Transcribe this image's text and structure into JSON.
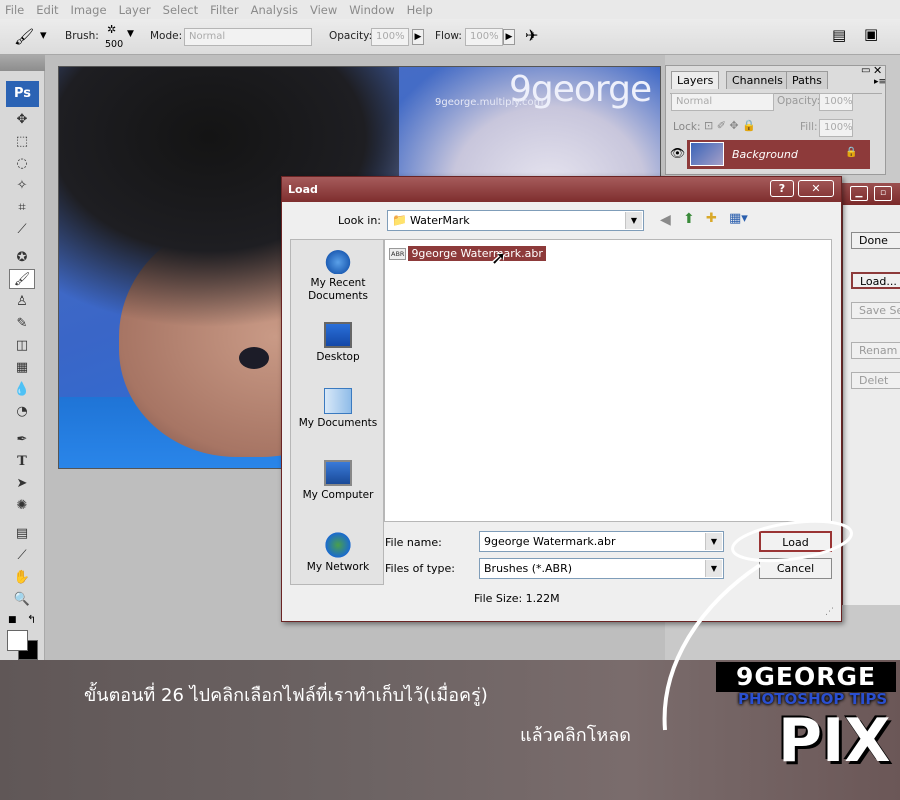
{
  "menu": [
    "File",
    "Edit",
    "Image",
    "Layer",
    "Select",
    "Filter",
    "Analysis",
    "View",
    "Window",
    "Help"
  ],
  "options": {
    "brush_label": "Brush:",
    "brush_size": "500",
    "mode_label": "Mode:",
    "mode_value": "Normal",
    "opacity_label": "Opacity:",
    "opacity_value": "100%",
    "flow_label": "Flow:",
    "flow_value": "100%"
  },
  "toolbox": {
    "logo": "Ps"
  },
  "watermark": {
    "small": "9george.multiply.com",
    "big": "9george"
  },
  "layers_panel": {
    "tabs": [
      "Layers",
      "Channels",
      "Paths"
    ],
    "blend_mode": "Normal",
    "opacity_label": "Opacity:",
    "opacity_value": "100%",
    "lock_label": "Lock:",
    "fill_label": "Fill:",
    "fill_value": "100%",
    "layer_name": "Background"
  },
  "preset_manager": {
    "buttons": [
      "Done",
      "Load...",
      "Save Se",
      "Renam",
      "Delet"
    ]
  },
  "load_dialog": {
    "title": "Load",
    "look_in_label": "Look in:",
    "look_in_value": "WaterMark",
    "places": [
      "My Recent Documents",
      "Desktop",
      "My Documents",
      "My Computer",
      "My Network"
    ],
    "file_item": "9george Watermark.abr",
    "file_item_tag": "ABR",
    "file_name_label": "File name:",
    "file_name_value": "9george Watermark.abr",
    "files_of_type_label": "Files of type:",
    "files_of_type_value": "Brushes (*.ABR)",
    "load_button": "Load",
    "cancel_button": "Cancel",
    "file_size": "File Size: 1.22M"
  },
  "banner": {
    "line1": "ขั้นตอนที่ 26 ไปคลิกเลือกไฟล์ที่เราทำเก็บไว้(เมื่อครู่)",
    "line2": "แล้วคลิกโหลด",
    "logo_top": "9GEORGE",
    "logo_mid": "PHOTOSHOP TIPS",
    "logo_bottom": "PIX"
  },
  "colors": {
    "accent": "#8d3a3a",
    "title_bar": "#7e2e2e",
    "ps_blue": "#2b63b4"
  }
}
